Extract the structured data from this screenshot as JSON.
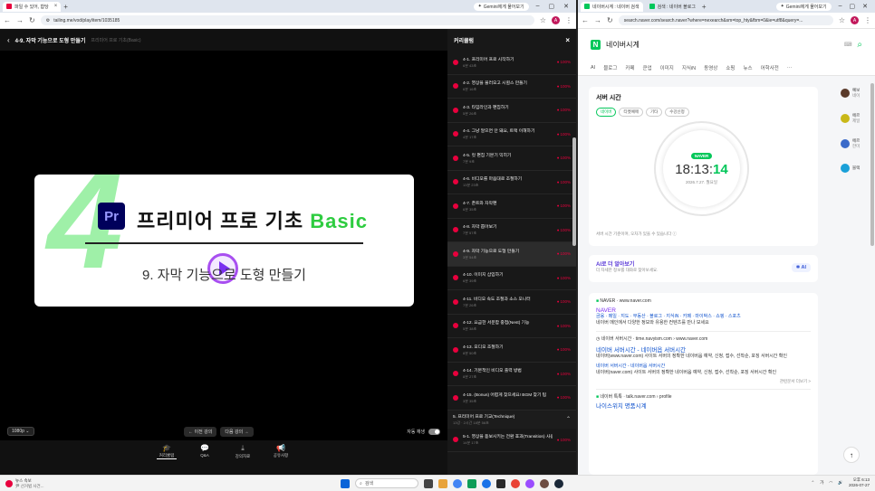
{
  "left_browser": {
    "tab_title": "파일 수 있어, 합당",
    "url": "tailing.me/vod/play/item/1035185",
    "gemini": "Gemini에게 물어보기"
  },
  "player": {
    "title": "4-9. 자막 기능으로 도형 만들기",
    "subtitle": "프리미어 프로 기초(Basic)",
    "slide_number": "4",
    "logo": "Pr",
    "headline_main": "프리미어 프로 기초 ",
    "headline_accent": "Basic",
    "slide_subtitle": "9. 자막 기능으로 도형 만들기",
    "quality": "1080p",
    "prev": "← 이전 강의",
    "next": "다음 강의 →",
    "autoplay": "자동 재생",
    "tools": [
      {
        "label": "커리큘럼",
        "icon": "graduation-cap-icon",
        "glyph": "🎓"
      },
      {
        "label": "Q&A",
        "icon": "chat-icon",
        "glyph": "💬"
      },
      {
        "label": "강의자료",
        "icon": "download-icon",
        "glyph": "⤓"
      },
      {
        "label": "공유사항",
        "icon": "megaphone-icon",
        "glyph": "📢"
      }
    ]
  },
  "curriculum": {
    "header": "커리큘럼",
    "items": [
      {
        "title": "4-1. 프리미어 프로 시작하기",
        "dur": "6분 43초",
        "pct": "100%"
      },
      {
        "title": "4-2. 영상을 불러오고 시퀀스 만들기",
        "dur": "6분 16초",
        "pct": "100%"
      },
      {
        "title": "4-3. 타임라인과 편집하기",
        "dur": "5분 26초",
        "pct": "100%"
      },
      {
        "title": "4-4. 그냥 알으면 안 돼요, 트랙 이해하기",
        "dur": "4분 17초",
        "pct": "100%"
      },
      {
        "title": "4-5. 컷 편집 기본기 익히기",
        "dur": "7분 9초",
        "pct": "100%"
      },
      {
        "title": "4-6. 비디오를 마음대로 조절하기",
        "dur": "13분 23초",
        "pct": "100%"
      },
      {
        "title": "4-7. 존트와 자막편",
        "dur": "6분 35초",
        "pct": "100%"
      },
      {
        "title": "4-8. 자막 뽑아보기",
        "dur": "7분 57초",
        "pct": "100%"
      },
      {
        "title": "4-9. 자막 기능으로 도형 만들기",
        "dur": "3분 54초",
        "pct": "100%",
        "active": true
      },
      {
        "title": "4-10. 이미지 삽입하기",
        "dur": "6분 39초",
        "pct": "100%"
      },
      {
        "title": "4-11. 비디오 속도 조절과 소스 모니터",
        "dur": "7분 26초",
        "pct": "100%"
      },
      {
        "title": "4-12. 요금한 서운함 중첩(Nest) 기능",
        "dur": "5분 38초",
        "pct": "100%"
      },
      {
        "title": "4-13. 오디오 조절하기",
        "dur": "8분 50초",
        "pct": "100%"
      },
      {
        "title": "4-14. 기본적인 비디오 출력 방법",
        "dur": "8분 27초",
        "pct": "100%"
      },
      {
        "title": "4-15. (Bonus) 어렵게 찾으세요! BGM 찾기 팁",
        "dur": "3분 35초",
        "pct": "100%"
      }
    ],
    "section": {
      "title": "5. 프리미어 프로 기교(Technique)",
      "sub": "13강 · 2시간 18분 56초"
    },
    "last": {
      "title": "5-1. 영상을 돋보시키는 전환 효과(Transition) 사용하기",
      "dur": "14분 17초",
      "pct": "100%"
    }
  },
  "right_browser": {
    "tab1": "네이버시계 : 네이버 검색",
    "tab2": "검색 : 네이버 블로그",
    "gemini": "Gemini에게 물어보기",
    "url": "search.naver.com/search.naver?where=nexearch&sm=top_hty&fbm=0&ie=utf8&query=..."
  },
  "naver": {
    "query": "네이버시계",
    "tabs": [
      "AI",
      "블로그",
      "카페",
      "쿤업",
      "이미지",
      "지식iN",
      "동영상",
      "쇼핑",
      "뉴스",
      "어학사전",
      "···"
    ],
    "card_title": "서버 시간",
    "chips": [
      "네이버",
      "티켓예매",
      "기타",
      "수강신청"
    ],
    "clock_badge": "NAVER",
    "time_hm": "18:13:",
    "time_s": "14",
    "date": "2026.7.27. 월요일",
    "note": "서버 시간 기준이며, 오차가 있을 수 있습니다 ⓘ",
    "ai_title": "AI로 더 알아보기",
    "ai_sub": "더 자세한 정보를 대화로 찾아보세요.",
    "ai_btn": "AI",
    "r1_site": "NAVER · www.naver.com",
    "r1_title": "NAVER",
    "r1_links": "금융 · 메일 · 지도 · 부동산 · 블로그 · 지식iN · 카페 · 마이박스 · 쇼핑 · 스포츠",
    "r1_desc": "네이버 메인에서 다양한 정보와 유용한 컨텐츠를 만나 보세요",
    "r2_site": "네이버 서버시간 · time.navyism.com › www.naver.com",
    "r2_title": "네이버 서버시간 - 네이버옵 서버시간",
    "r2_desc": "네이버(www.naver.com) 사이트 서버의 정확한 네이버옵 예약, 신청, 접수, 선착순, 포징 서버시간 확인",
    "r3_title": "네이버 서버시간 - 네이버옵 서버시간",
    "r3_desc": "네이버(naver.com) 사이트 서버의 정확한 네이버옵 예약, 신청, 접수, 선착순, 포징 서버시간 확인",
    "more": "관련문서 더보기 >",
    "r4_site": "네이버 톡톡 · talk.naver.com › profile",
    "r4_title": "나이스위치 명품시계",
    "side": [
      {
        "label": "예보",
        "sub": "네이",
        "color": "#5a3a2a"
      },
      {
        "label": "에르",
        "sub": "제일",
        "color": "#c9b818"
      },
      {
        "label": "에르",
        "sub": "한미",
        "color": "#3a6ac9"
      },
      {
        "label": "블랙",
        "sub": "",
        "color": "#1aa0d8"
      }
    ]
  },
  "taskbar": {
    "weather": "뉴스 속보",
    "weather_sub": "尹 선거법 사건...",
    "search": "검색",
    "time": "오후 6:13",
    "date": "2026-07-27",
    "lang": "가"
  }
}
